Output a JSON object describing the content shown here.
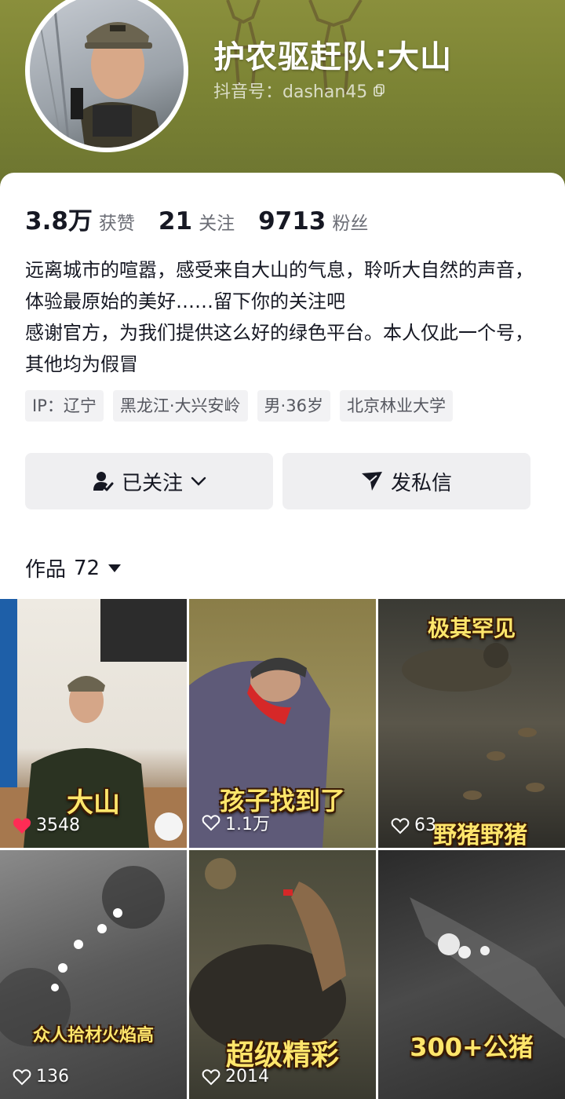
{
  "profile": {
    "name": "护农驱赶队:大山",
    "douyin_id": "抖音号：dashan45"
  },
  "stats": [
    {
      "value": "3.8万",
      "label": "获赞"
    },
    {
      "value": "21",
      "label": "关注"
    },
    {
      "value": "9713",
      "label": "粉丝"
    }
  ],
  "bio": "远离城市的喧嚣，感受来自大山的气息，聆听大自然的声音，体验最原始的美好……留下你的关注吧\n感谢官方，为我们提供这么好的绿色平台。本人仅此一个号，其他均为假冒",
  "tags": [
    "IP：辽宁",
    "黑龙江·大兴安岭",
    "男·36岁",
    "北京林业大学"
  ],
  "actions": {
    "follow_label": "已关注",
    "message_label": "发私信"
  },
  "works": {
    "label": "作品",
    "count": "72"
  },
  "videos": [
    {
      "title": "大山",
      "likes": "3548",
      "liked": true
    },
    {
      "title": "孩子找到了",
      "likes": "1.1万",
      "liked": false
    },
    {
      "title_top": "极其罕见",
      "title": "野猪野猪",
      "likes": "63",
      "liked": false
    },
    {
      "title": "众人拾材火焰高",
      "likes": "136",
      "liked": false
    },
    {
      "title": "超级精彩",
      "likes": "2014",
      "liked": false
    },
    {
      "title": "300+公猪",
      "likes": "",
      "liked": false
    }
  ],
  "colors": {
    "like_red": "#fe2c55",
    "title_yellow": "#ffe66b",
    "hero_green": "#7b8334"
  },
  "icons": [
    "copy-icon",
    "user-check-icon",
    "chevron-down-icon",
    "send-icon",
    "caret-down-icon",
    "heart-icon"
  ]
}
